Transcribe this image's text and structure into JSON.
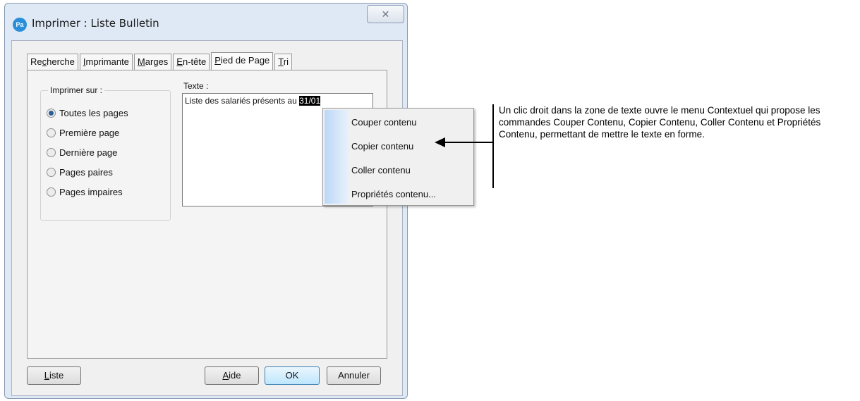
{
  "window": {
    "title": "Imprimer : Liste Bulletin",
    "icon_text": "Pa",
    "close_glyph": "✕"
  },
  "tabs": [
    {
      "pre": "Re",
      "u": "c",
      "post": "herche"
    },
    {
      "pre": "",
      "u": "I",
      "post": "mprimante"
    },
    {
      "pre": "",
      "u": "M",
      "post": "arges"
    },
    {
      "pre": "",
      "u": "E",
      "post": "n-tête"
    },
    {
      "pre": "",
      "u": "P",
      "post": "ied de Page"
    },
    {
      "pre": "",
      "u": "T",
      "post": "ri"
    }
  ],
  "print_on": {
    "title": "Imprimer sur :",
    "options": [
      "Toutes les pages",
      "Première page",
      "Dernière page",
      "Pages paires",
      "Pages impaires"
    ],
    "selected_index": 0
  },
  "text_field": {
    "label": "Texte :",
    "value": "Liste des salariés présents au ",
    "selected_value": "31/01"
  },
  "buttons": {
    "liste": {
      "u": "L",
      "post": "iste"
    },
    "aide": {
      "u": "A",
      "post": "ide"
    },
    "ok": "OK",
    "annuler": "Annuler"
  },
  "context_menu": {
    "items": [
      "Couper contenu",
      "Copier contenu",
      "Coller contenu",
      "Propriétés  contenu..."
    ]
  },
  "annotation": {
    "text": "Un clic droit dans la zone de texte ouvre le menu Contextuel qui propose les commandes Couper Contenu, Copier Contenu, Coller Contenu et Propriétés Contenu, permettant de mettre le texte en forme."
  }
}
